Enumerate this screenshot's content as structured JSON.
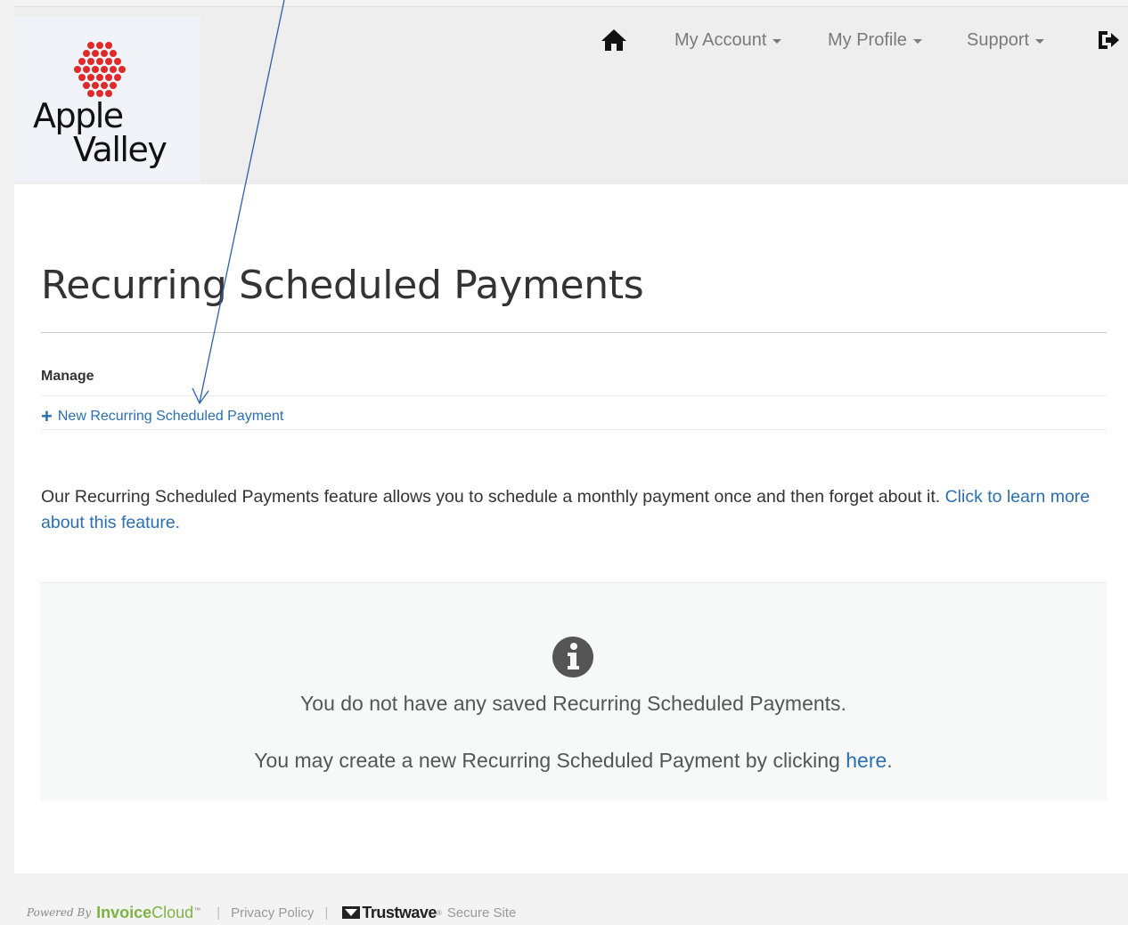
{
  "logo": {
    "line1": "Apple",
    "line2": "Valley",
    "dot_color": "#e02a2a"
  },
  "nav": {
    "home_icon": "home-icon",
    "my_account": "My Account",
    "my_profile": "My Profile",
    "support": "Support",
    "logout_icon": "sign-out-icon"
  },
  "page": {
    "title": "Recurring Scheduled Payments",
    "manage_label": "Manage",
    "new_link": "New Recurring Scheduled Payment",
    "description": "Our Recurring Scheduled Payments feature allows you to schedule a monthly payment once and then forget about it. ",
    "learn_more": "Click to learn more about this feature.",
    "empty_message": "You do not have any saved Recurring Scheduled Payments.",
    "create_prefix": "You may create a new Recurring Scheduled Payment by clicking ",
    "create_link": "here",
    "create_suffix": "."
  },
  "footer": {
    "powered_by": "Powered By",
    "brand_bold": "Invoice",
    "brand_light": "Cloud",
    "brand_tm": "™",
    "privacy": "Privacy Policy",
    "trustwave": "Trustwave",
    "trustwave_tm": "®",
    "secure_site": "Secure Site"
  },
  "colors": {
    "link": "#2b6fb0",
    "brand_green": "#7cb342",
    "annotation_arrow": "#2d5fa8"
  }
}
